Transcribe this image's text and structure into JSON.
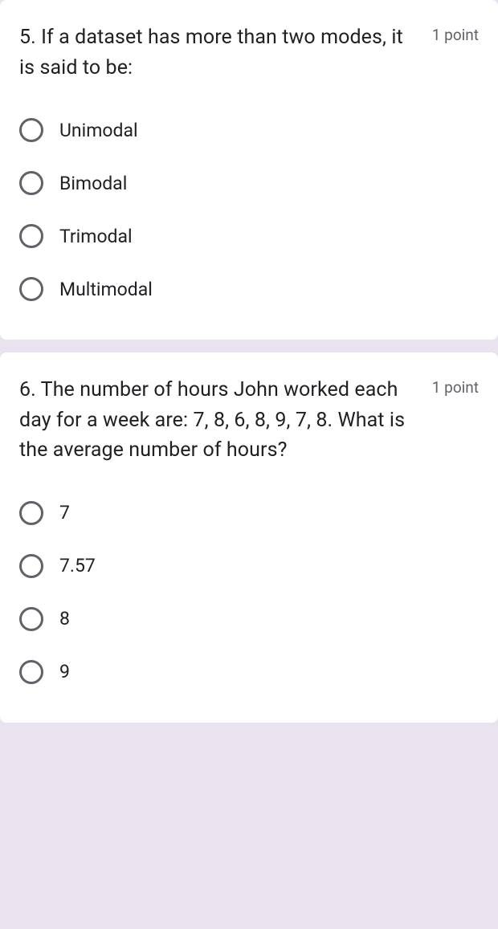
{
  "questions": [
    {
      "number": "5.",
      "text": "If a dataset has more than two modes, it is said to be:",
      "points": "1 point",
      "options": [
        "Unimodal",
        "Bimodal",
        "Trimodal",
        "Multimodal"
      ]
    },
    {
      "number": "6.",
      "text": "The number of hours John worked each day for a week are: 7, 8, 6, 8, 9, 7, 8. What is the average number of hours?",
      "points": "1 point",
      "options": [
        "7",
        "7.57",
        "8",
        "9"
      ]
    }
  ]
}
